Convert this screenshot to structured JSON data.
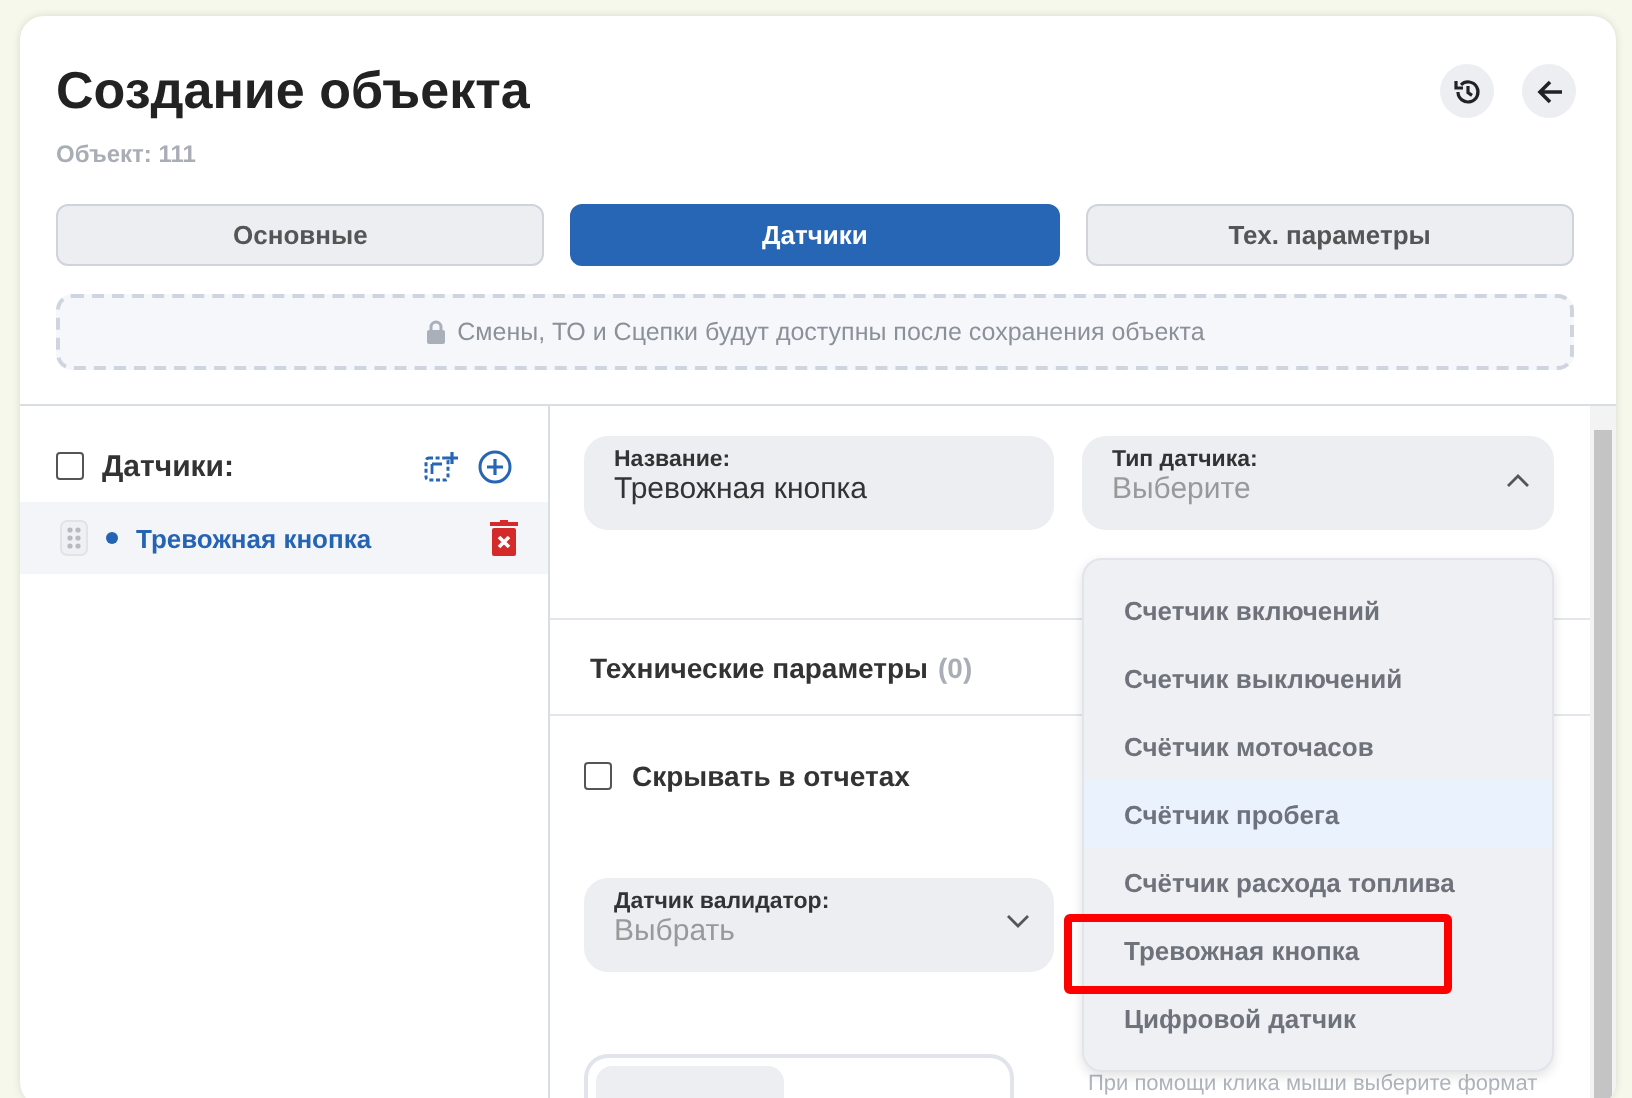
{
  "header": {
    "title": "Создание объекта",
    "subtitle": "Объект: 111"
  },
  "tabs": [
    {
      "label": "Основные",
      "selected": false
    },
    {
      "label": "Датчики",
      "selected": true
    },
    {
      "label": "Тех. параметры",
      "selected": false
    }
  ],
  "notice": "Смены, ТО и Сцепки будут доступны после сохранения объекта",
  "sensor_list": {
    "title": "Датчики:",
    "all_checked": false,
    "items": [
      {
        "name": "Тревожная кнопка",
        "selected": true
      }
    ]
  },
  "form": {
    "name_field": {
      "label": "Название:",
      "value": "Тревожная кнопка"
    },
    "type_field": {
      "label": "Тип датчика:",
      "placeholder": "Выберите",
      "expanded": true,
      "options": [
        {
          "label": "Счетчик включений",
          "hovered": false,
          "highlighted": false
        },
        {
          "label": "Счетчик выключений",
          "hovered": false,
          "highlighted": false
        },
        {
          "label": "Счётчик моточасов",
          "hovered": false,
          "highlighted": false
        },
        {
          "label": "Счётчик пробега",
          "hovered": true,
          "highlighted": false
        },
        {
          "label": "Счётчик расхода топлива",
          "hovered": false,
          "highlighted": false
        },
        {
          "label": "Тревожная кнопка",
          "hovered": false,
          "highlighted": true
        },
        {
          "label": "Цифровой датчик",
          "hovered": false,
          "highlighted": false
        }
      ]
    },
    "tech_params": {
      "title": "Технические параметры",
      "count": "(0)"
    },
    "hide_in_reports": {
      "label": "Скрывать в отчетах",
      "checked": false
    },
    "validator_field": {
      "label": "Датчик валидатор:",
      "placeholder": "Выбрать"
    },
    "hint": "При помощи клика мыши выберите формат"
  }
}
